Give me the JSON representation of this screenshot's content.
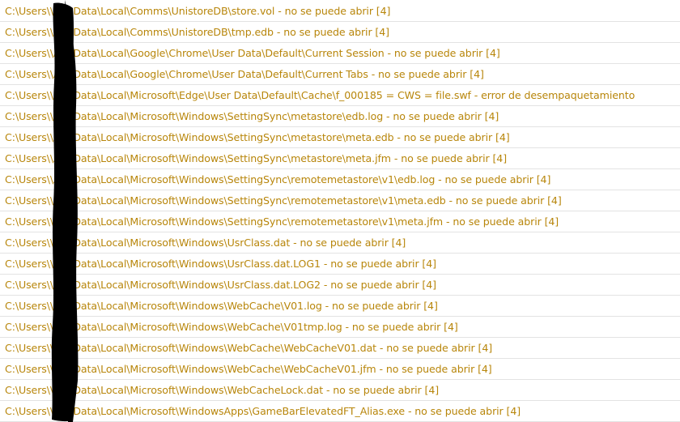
{
  "log": {
    "rows": [
      "C:\\Users\\\\AppData\\Local\\Comms\\UnistoreDB\\store.vol - no se puede abrir [4]",
      "C:\\Users\\\\AppData\\Local\\Comms\\UnistoreDB\\tmp.edb - no se puede abrir [4]",
      "C:\\Users\\\\AppData\\Local\\Google\\Chrome\\User Data\\Default\\Current Session - no se puede abrir [4]",
      "C:\\Users\\\\AppData\\Local\\Google\\Chrome\\User Data\\Default\\Current Tabs - no se puede abrir [4]",
      "C:\\Users\\\\AppData\\Local\\Microsoft\\Edge\\User Data\\Default\\Cache\\f_000185 = CWS = file.swf - error de desempaquetamiento",
      "C:\\Users\\\\AppData\\Local\\Microsoft\\Windows\\SettingSync\\metastore\\edb.log - no se puede abrir [4]",
      "C:\\Users\\\\AppData\\Local\\Microsoft\\Windows\\SettingSync\\metastore\\meta.edb - no se puede abrir [4]",
      "C:\\Users\\\\AppData\\Local\\Microsoft\\Windows\\SettingSync\\metastore\\meta.jfm - no se puede abrir [4]",
      "C:\\Users\\\\AppData\\Local\\Microsoft\\Windows\\SettingSync\\remotemetastore\\v1\\edb.log - no se puede abrir [4]",
      "C:\\Users\\\\AppData\\Local\\Microsoft\\Windows\\SettingSync\\remotemetastore\\v1\\meta.edb - no se puede abrir [4]",
      "C:\\Users\\\\AppData\\Local\\Microsoft\\Windows\\SettingSync\\remotemetastore\\v1\\meta.jfm - no se puede abrir [4]",
      "C:\\Users\\\\AppData\\Local\\Microsoft\\Windows\\UsrClass.dat - no se puede abrir [4]",
      "C:\\Users\\\\AppData\\Local\\Microsoft\\Windows\\UsrClass.dat.LOG1 - no se puede abrir [4]",
      "C:\\Users\\\\AppData\\Local\\Microsoft\\Windows\\UsrClass.dat.LOG2 - no se puede abrir [4]",
      "C:\\Users\\\\AppData\\Local\\Microsoft\\Windows\\WebCache\\V01.log - no se puede abrir [4]",
      "C:\\Users\\\\AppData\\Local\\Microsoft\\Windows\\WebCache\\V01tmp.log - no se puede abrir [4]",
      "C:\\Users\\\\AppData\\Local\\Microsoft\\Windows\\WebCache\\WebCacheV01.dat - no se puede abrir [4]",
      "C:\\Users\\\\AppData\\Local\\Microsoft\\Windows\\WebCache\\WebCacheV01.jfm - no se puede abrir [4]",
      "C:\\Users\\\\AppData\\Local\\Microsoft\\Windows\\WebCacheLock.dat - no se puede abrir [4]",
      "C:\\Users\\\\AppData\\Local\\Microsoft\\WindowsApps\\GameBarElevatedFT_Alias.exe - no se puede abrir [4]"
    ]
  },
  "colors": {
    "text": "#b8860b",
    "divider": "#e3e3e3",
    "redaction": "#000000",
    "background": "#ffffff"
  }
}
